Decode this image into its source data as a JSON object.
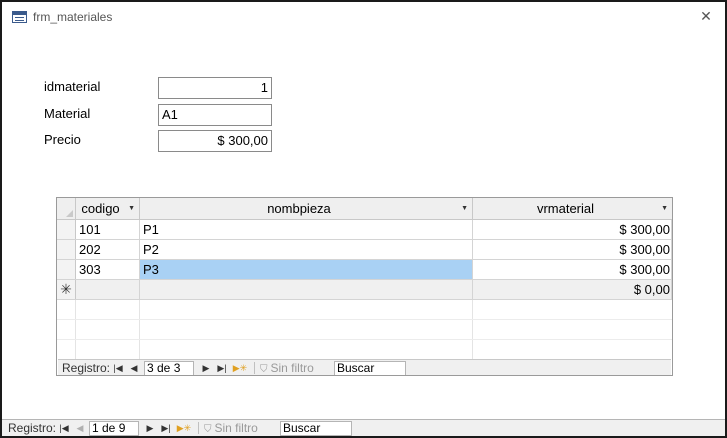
{
  "window": {
    "title": "frm_materiales",
    "icon": "form-icon",
    "close_icon": "close-icon"
  },
  "form": {
    "fields": [
      {
        "label": "idmaterial",
        "value": "1",
        "align": "right"
      },
      {
        "label": "Material",
        "value": "A1",
        "align": "left"
      },
      {
        "label": "Precio",
        "value": "$ 300,00",
        "align": "right"
      }
    ]
  },
  "subform": {
    "columns": [
      {
        "label": "codigo",
        "has_dropdown": true
      },
      {
        "label": "nombpieza",
        "has_dropdown": true
      },
      {
        "label": "vrmaterial",
        "has_dropdown": true
      }
    ],
    "rows": [
      {
        "codigo": "101",
        "nombpieza": "P1",
        "vrmaterial": "$ 300,00"
      },
      {
        "codigo": "202",
        "nombpieza": "P2",
        "vrmaterial": "$ 300,00"
      },
      {
        "codigo": "303",
        "nombpieza": "P3",
        "vrmaterial": "$ 300,00",
        "selected_cell": "nombpieza"
      }
    ],
    "new_row": {
      "marker": "✳",
      "vrmaterial": "$ 0,00"
    },
    "nav": {
      "label": "Registro:",
      "record": "3 de 3",
      "filter": "Sin filtro",
      "search": "Buscar"
    }
  },
  "main_nav": {
    "label": "Registro:",
    "record": "1 de 9",
    "filter": "Sin filtro",
    "search": "Buscar"
  },
  "colors": {
    "selection": "#a9d1f4",
    "new_record_icon": "#e0a020"
  }
}
